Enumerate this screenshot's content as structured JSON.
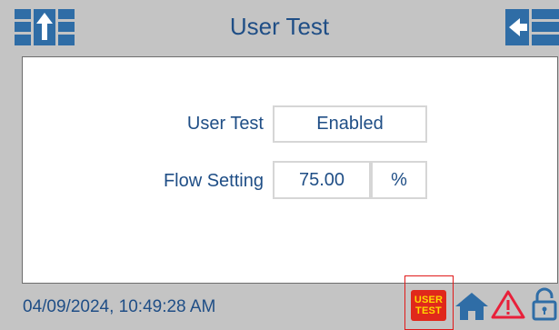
{
  "header": {
    "title": "User Test",
    "left_icon": "nav-up-icon",
    "right_icon": "nav-back-icon"
  },
  "form": {
    "user_test": {
      "label": "User Test",
      "value": "Enabled"
    },
    "flow_setting": {
      "label": "Flow Setting",
      "value": "75.00",
      "unit": "%"
    }
  },
  "footer": {
    "timestamp": "04/09/2024, 10:49:28 AM",
    "user_test_badge": {
      "line1": "USER",
      "line2": "TEST"
    },
    "icons": [
      "user-test-icon",
      "home-icon",
      "warning-icon",
      "unlocked-icon"
    ]
  },
  "colors": {
    "accent_text": "#1f4e86",
    "icon_blue": "#2f6da6",
    "background": "#c4c4c4",
    "alarm_red": "#e0281b",
    "badge_text": "#ffd800"
  }
}
